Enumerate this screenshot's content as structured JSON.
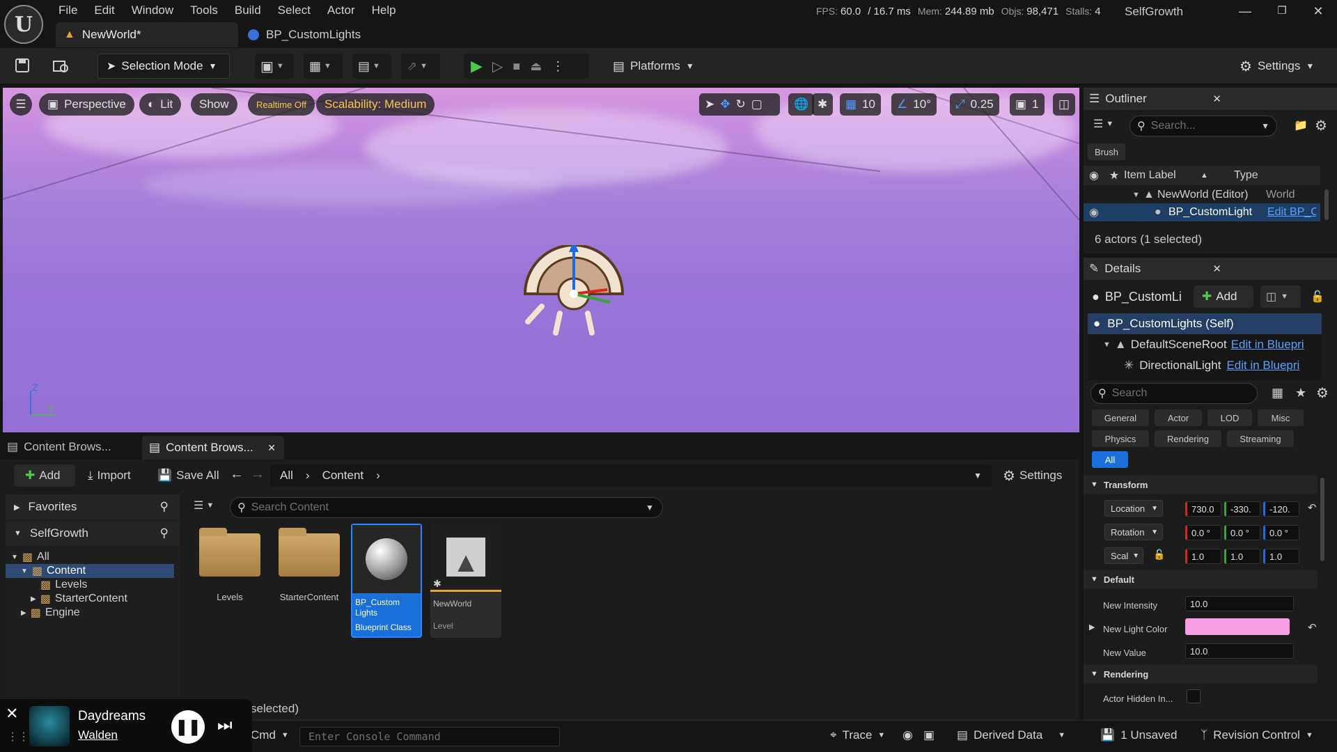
{
  "menu": [
    "File",
    "Edit",
    "Window",
    "Tools",
    "Build",
    "Select",
    "Actor",
    "Help"
  ],
  "stats": {
    "fps_label": "FPS:",
    "fps": "60.0",
    "ms": "/ 16.7 ms",
    "mem_label": "Mem:",
    "mem": "244.89 mb",
    "objs_label": "Objs:",
    "objs": "98,471",
    "stalls_label": "Stalls:",
    "stalls": "4"
  },
  "project_name": "SelfGrowth",
  "tabs": {
    "level": "NewWorld*",
    "blueprint": "BP_CustomLights"
  },
  "toolbar": {
    "selection_mode": "Selection Mode",
    "platforms": "Platforms",
    "settings": "Settings"
  },
  "viewport": {
    "perspective": "Perspective",
    "lit": "Lit",
    "show": "Show",
    "realtime": "Realtime Off",
    "scalability": "Scalability: Medium",
    "grid_snap": "10",
    "rot_snap": "10°",
    "scale_snap": "0.25",
    "cam_speed": "1",
    "axis_z": "Z",
    "axis_y": "Y"
  },
  "outliner": {
    "title": "Outliner",
    "search_placeholder": "Search...",
    "filter_chip": "Brush",
    "col_label": "Item Label",
    "col_type": "Type",
    "rows": [
      {
        "label": "NewWorld (Editor)",
        "type": "World"
      },
      {
        "label": "BP_CustomLight",
        "type": "Edit BP_C"
      }
    ],
    "footer": "6 actors (1 selected)"
  },
  "details": {
    "title": "Details",
    "object": "BP_CustomLi",
    "add": "Add",
    "components": [
      {
        "label": "BP_CustomLights (Self)",
        "action": ""
      },
      {
        "label": "DefaultSceneRoot",
        "action": "Edit in Bluepri"
      },
      {
        "label": "DirectionalLight",
        "action": "Edit in Bluepri"
      }
    ],
    "search_placeholder": "Search",
    "filters": [
      "General",
      "Actor",
      "LOD",
      "Misc",
      "Physics",
      "Rendering",
      "Streaming",
      "All"
    ],
    "transform": {
      "title": "Transform",
      "location_label": "Location",
      "location": [
        "730.0",
        "-330.",
        "-120."
      ],
      "rotation_label": "Rotation",
      "rotation": [
        "0.0 °",
        "0.0 °",
        "0.0 °"
      ],
      "scale_label": "Scal",
      "scale": [
        "1.0",
        "1.0",
        "1.0"
      ]
    },
    "default": {
      "title": "Default",
      "new_intensity_label": "New Intensity",
      "new_intensity": "10.0",
      "new_light_color_label": "New Light Color",
      "new_light_color": "#f59ee6",
      "new_value_label": "New Value",
      "new_value": "10.0"
    },
    "rendering": {
      "title": "Rendering",
      "actor_hidden_label": "Actor Hidden In..."
    }
  },
  "content_browser": {
    "tab1": "Content Brows...",
    "tab2": "Content Brows...",
    "add": "Add",
    "import": "Import",
    "save_all": "Save All",
    "crumbs": [
      "All",
      "Content"
    ],
    "settings": "Settings",
    "favorites": "Favorites",
    "project": "SelfGrowth",
    "tree": [
      "All",
      "Content",
      "Levels",
      "StarterContent",
      "Engine"
    ],
    "search_placeholder": "Search Content",
    "assets": [
      {
        "name": "Levels",
        "kind": ""
      },
      {
        "name": "StarterContent",
        "kind": ""
      },
      {
        "name": "BP_Custom Lights",
        "kind": "Blueprint Class"
      },
      {
        "name": "NewWorld",
        "kind": "Level"
      }
    ],
    "selection_info": "selected)"
  },
  "statusbar": {
    "cmd": "Cmd",
    "console_placeholder": "Enter Console Command",
    "trace": "Trace",
    "derived_data": "Derived Data",
    "unsaved": "1 Unsaved",
    "revision_control": "Revision Control"
  },
  "music": {
    "track": "Daydreams",
    "artist": "Walden"
  },
  "colors": {
    "accent": "#1a6fd8",
    "sky_top": "#d896e0",
    "sky_bottom": "#9470d6",
    "warning": "#f2c94c",
    "play": "#4cc94c"
  }
}
